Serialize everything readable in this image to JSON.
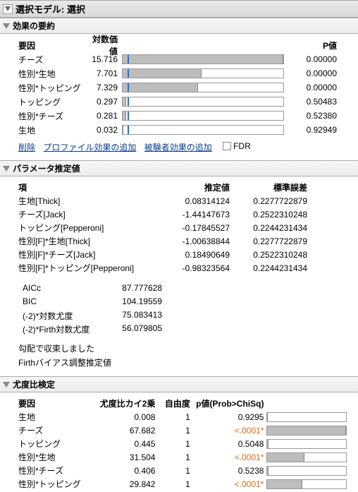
{
  "panel": {
    "title": "選択モデル: 選択",
    "effects_title": "効果の要約",
    "params_title": "パラメータ推定値",
    "lr_title": "尤度比検定"
  },
  "effects": {
    "header_factor": "要因",
    "header_log": "対数価値",
    "header_p": "P値",
    "rows": {
      "0": {
        "name": "チーズ",
        "log": "15.716",
        "p": "0.00000"
      },
      "1": {
        "name": "性別*生地",
        "log": "7.701",
        "p": "0.00000"
      },
      "2": {
        "name": "性別*トッピング",
        "log": "7.329",
        "p": "0.00000"
      },
      "3": {
        "name": "トッピング",
        "log": "0.297",
        "p": "0.50483"
      },
      "4": {
        "name": "性別*チーズ",
        "log": "0.281",
        "p": "0.52380"
      },
      "5": {
        "name": "生地",
        "log": "0.032",
        "p": "0.92949"
      }
    },
    "link_delete": "削除",
    "link_profile": "プロファイル効果の追加",
    "link_subject": "被験者効果の追加",
    "fdr_label": "FDR"
  },
  "params": {
    "header_term": "項",
    "header_est": "推定値",
    "header_se": "標準誤差",
    "rows": {
      "0": {
        "name": "生地[Thick]",
        "est": "0.08314124",
        "se": "0.2277722879"
      },
      "1": {
        "name": "チーズ[Jack]",
        "est": "-1.44147673",
        "se": "0.2522310248"
      },
      "2": {
        "name": "トッピング[Pepperoni]",
        "est": "-0.17845527",
        "se": "0.2244231434"
      },
      "3": {
        "name": "性別[F]*生地[Thick]",
        "est": "-1.00638844",
        "se": "0.2277722879"
      },
      "4": {
        "name": "性別[F]*チーズ[Jack]",
        "est": "0.18490649",
        "se": "0.2522310248"
      },
      "5": {
        "name": "性別[F]*トッピング[Pepperoni]",
        "est": "-0.98323564",
        "se": "0.2244231434"
      }
    },
    "stats": {
      "0": {
        "name": "AICc",
        "val": "87.777628"
      },
      "1": {
        "name": "BIC",
        "val": "104.19559"
      },
      "2": {
        "name": "(-2)*対数尤度",
        "val": "75.083413"
      },
      "3": {
        "name": "(-2)*Firth対数尤度",
        "val": "56.079805"
      }
    },
    "note_converge": "勾配で収束しました",
    "note_firth": "Firthバイアス調整推定値"
  },
  "lr": {
    "header_factor": "要因",
    "header_chi": "尤度比カイ2乗",
    "header_df": "自由度",
    "header_p": "p値(Prob>ChiSq)",
    "rows": {
      "0": {
        "name": "生地",
        "chi": "0.008",
        "df": "1",
        "p": "0.9295",
        "sig": false
      },
      "1": {
        "name": "チーズ",
        "chi": "67.682",
        "df": "1",
        "p": "<.0001*",
        "sig": true
      },
      "2": {
        "name": "トッピング",
        "chi": "0.445",
        "df": "1",
        "p": "0.5048",
        "sig": false
      },
      "3": {
        "name": "性別*生地",
        "chi": "31.504",
        "df": "1",
        "p": "<.0001*",
        "sig": true
      },
      "4": {
        "name": "性別*チーズ",
        "chi": "0.406",
        "df": "1",
        "p": "0.5238",
        "sig": false
      },
      "5": {
        "name": "性別*トッピング",
        "chi": "29.842",
        "df": "1",
        "p": "<.0001*",
        "sig": true
      }
    }
  },
  "chart_data": [
    {
      "type": "bar",
      "title": "効果の要約",
      "orientation": "horizontal",
      "categories": [
        "チーズ",
        "性別*生地",
        "性別*トッピング",
        "トッピング",
        "性別*チーズ",
        "生地"
      ],
      "values": [
        15.716,
        7.701,
        7.329,
        0.297,
        0.281,
        0.032
      ],
      "xlabel": "対数価値",
      "reference_line": 2.0
    },
    {
      "type": "bar",
      "title": "尤度比検定",
      "orientation": "horizontal",
      "categories": [
        "生地",
        "チーズ",
        "トッピング",
        "性別*生地",
        "性別*チーズ",
        "性別*トッピング"
      ],
      "values": [
        0.008,
        67.682,
        0.445,
        31.504,
        0.406,
        29.842
      ],
      "xlabel": "尤度比カイ2乗"
    }
  ]
}
